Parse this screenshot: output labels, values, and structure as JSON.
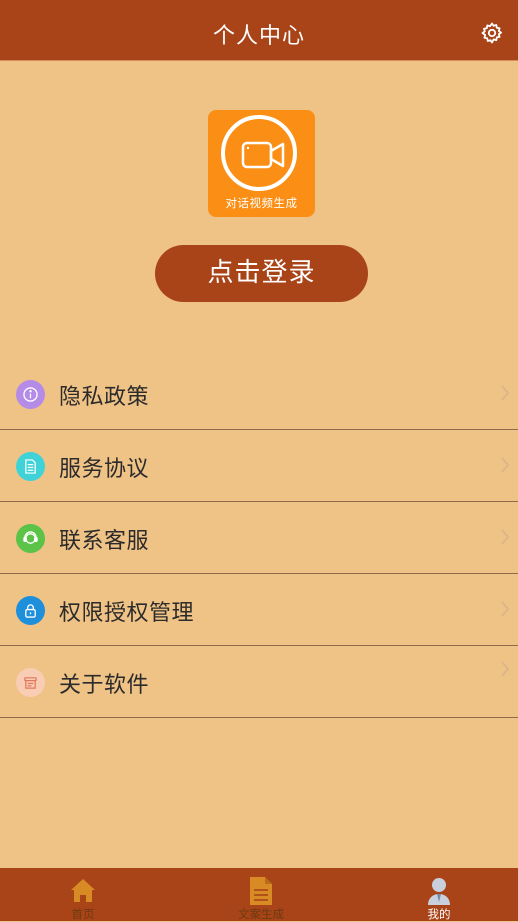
{
  "header": {
    "title": "个人中心",
    "settings_icon": "gear-icon"
  },
  "logo": {
    "caption": "对话视频生成",
    "icon": "video-camera-icon",
    "bg_color": "#fb8f16"
  },
  "login": {
    "label": "点击登录"
  },
  "menu": [
    {
      "label": "隐私政策",
      "icon": "info-icon",
      "color": "#b48be6"
    },
    {
      "label": "服务协议",
      "icon": "document-icon",
      "color": "#3fd3d8"
    },
    {
      "label": "联系客服",
      "icon": "headset-icon",
      "color": "#5ac348"
    },
    {
      "label": "权限授权管理",
      "icon": "lock-icon",
      "color": "#1e8fdb"
    },
    {
      "label": "关于软件",
      "icon": "box-icon",
      "color": "#f9cdb3"
    }
  ],
  "tabs": [
    {
      "label": "首页",
      "icon": "home-icon",
      "active": false
    },
    {
      "label": "文案生成",
      "icon": "file-icon",
      "active": false
    },
    {
      "label": "我的",
      "icon": "user-icon",
      "active": true
    }
  ],
  "colors": {
    "primary": "#a84418",
    "background": "#efc286"
  }
}
